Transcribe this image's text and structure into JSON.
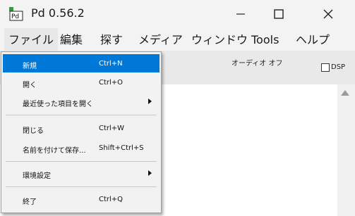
{
  "window": {
    "title": "Pd 0.56.2",
    "app_icon_text": "Pd"
  },
  "menubar": {
    "items": [
      "ファイル",
      "編集",
      "探す",
      "メディア",
      "ウィンドウ",
      "Tools",
      "ヘルプ"
    ]
  },
  "console": {
    "audio_status": "オーディオ オフ",
    "dsp_label": "DSP",
    "dsp_checked": false
  },
  "file_menu": {
    "items": [
      {
        "label": "新規",
        "shortcut": "Ctrl+N",
        "highlighted": true
      },
      {
        "label": "開く",
        "shortcut": "Ctrl+O"
      },
      {
        "label": "最近使った項目を開く",
        "shortcut": "",
        "submenu": true
      },
      {
        "label": "閉じる",
        "shortcut": "Ctrl+W"
      },
      {
        "label": "名前を付けて保存...",
        "shortcut": "Shift+Ctrl+S"
      },
      {
        "label": "環境設定",
        "shortcut": "",
        "submenu": true
      },
      {
        "label": "終了",
        "shortcut": "Ctrl+Q"
      }
    ]
  },
  "colors": {
    "highlight": "#0078d7",
    "pd_icon_green": "#2e9d3a"
  }
}
